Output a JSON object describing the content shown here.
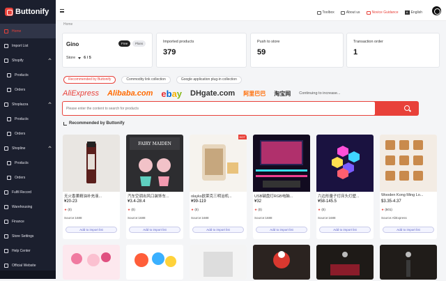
{
  "app": {
    "name": "Buttonify"
  },
  "sidebar": {
    "items": [
      {
        "label": "Home"
      },
      {
        "label": "Import List"
      },
      {
        "label": "Shopify"
      },
      {
        "label": "Products"
      },
      {
        "label": "Orders"
      },
      {
        "label": "Shoplazza"
      },
      {
        "label": "Products"
      },
      {
        "label": "Orders"
      },
      {
        "label": "Shopline"
      },
      {
        "label": "Products"
      },
      {
        "label": "Orders"
      },
      {
        "label": "Fulfil Record"
      },
      {
        "label": "Warehousing"
      },
      {
        "label": "Finance"
      },
      {
        "label": "Store Settings"
      },
      {
        "label": "Help Center"
      },
      {
        "label": "Official Website"
      }
    ]
  },
  "topbar": {
    "toolbox": "Toolbox",
    "about": "About us",
    "guidance": "Novice Guidance",
    "language": "English",
    "lang_icon": "A"
  },
  "breadcrumb": "Home",
  "store_card": {
    "name": "Gino",
    "badge_free": "Free",
    "badge_plans": "Plans",
    "store_label": "Store",
    "store_count": "6 / 5"
  },
  "stats": [
    {
      "label": "Imported products",
      "value": "379"
    },
    {
      "label": "Push to store",
      "value": "59"
    },
    {
      "label": "Transaction order",
      "value": "1"
    }
  ],
  "tabs": [
    {
      "label": "Recommended by Buttonify"
    },
    {
      "label": "Commodity link collection"
    },
    {
      "label": "Google application plug-in collection"
    }
  ],
  "platforms": {
    "aliexpress": "AliExpress",
    "alibaba": "Alibaba.com",
    "ebay": [
      "e",
      "b",
      "a",
      "y"
    ],
    "dhgate": "DHgate.com",
    "p1688": "阿里巴巴",
    "taobao": "淘宝网",
    "more": "Continuing to increase..."
  },
  "search": {
    "placeholder": "Please enter the content to search for products"
  },
  "section_title": "Recommended by Buttonify",
  "products": [
    {
      "title": "无火香薰精油补充液...",
      "price": "¥20-23",
      "rating": "(0)",
      "source": "Source:1688",
      "button": "Add to import list",
      "hot": ""
    },
    {
      "title": "汽车空调出风口装饰车...",
      "price": "¥3.4-28.4",
      "rating": "(0)",
      "source": "Source:1688",
      "button": "Add to import list",
      "hot": ""
    },
    {
      "title": "olayks欧莱克三明治机...",
      "price": "¥99-119",
      "rating": "(0)",
      "source": "Source:1688",
      "button": "Add to import list",
      "hot": "HOT"
    },
    {
      "title": "USB键盘灯RGB电脑...",
      "price": "¥32",
      "rating": "(0)",
      "source": "Source:1688",
      "button": "Add to import list",
      "hot": ""
    },
    {
      "title": "六边形量子灯床头灯壁...",
      "price": "¥58-145.5",
      "rating": "(0)",
      "source": "Source:1688",
      "button": "Add to import list",
      "hot": ""
    },
    {
      "title": "Wooden Kong Ming Lo...",
      "price": "$3.35-4.37",
      "rating": "(501)",
      "source": "Source:AliExpress",
      "button": "Add to import list",
      "hot": ""
    }
  ],
  "image_texts": {
    "fairy": "FAIRY MAIDEN"
  },
  "colors": {
    "accent": "#e8413a",
    "sidebar": "#1b1f2e"
  }
}
